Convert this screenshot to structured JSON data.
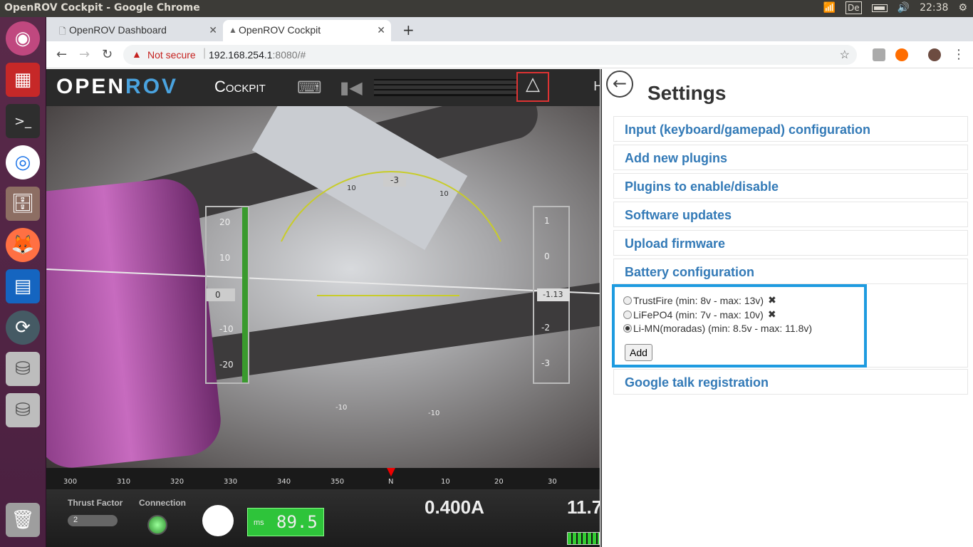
{
  "window_title": "OpenROV Cockpit - Google Chrome",
  "panel": {
    "keyboard_layout": "De",
    "clock": "22:38"
  },
  "tabs": [
    {
      "label": "OpenROV Dashboard"
    },
    {
      "label": "OpenROV Cockpit"
    }
  ],
  "address_bar": {
    "security_label": "Not secure",
    "host": "192.168.254.1",
    "port_path": ":8080/#"
  },
  "cockpit": {
    "logo_open": "OPEN",
    "logo_rov": "ROV",
    "title": "Cockpit",
    "depth_ticks": [
      "20",
      "10",
      "0",
      "-10",
      "-20"
    ],
    "depth_value": "0",
    "pitch_center": "-3",
    "pitch_labels": [
      "10",
      "10",
      "-10",
      "-10"
    ],
    "right_ticks": [
      "1",
      "0",
      "-1",
      "-2",
      "-3"
    ],
    "right_value": "-1.13",
    "compass_ticks": [
      "300",
      "310",
      "320",
      "330",
      "340",
      "350",
      "N",
      "10",
      "20",
      "30"
    ],
    "thrust_label": "Thrust Factor",
    "thrust_value": "2",
    "connection_label": "Connection",
    "ms_label": "ms",
    "ms_value": "89.5",
    "current": "0.400A",
    "voltage_partial": "11.7"
  },
  "settings": {
    "title": "Settings",
    "items": [
      "Input (keyboard/gamepad) configuration",
      "Add new plugins",
      "Plugins to enable/disable",
      "Software updates",
      "Upload firmware",
      "Battery configuration",
      "Google talk registration"
    ],
    "batteries": [
      {
        "label": "TrustFire (min: 8v - max: 13v)",
        "remove": "✖",
        "checked": false
      },
      {
        "label": "LiFePO4 (min: 7v - max: 10v)",
        "remove": "✖",
        "checked": false
      },
      {
        "label": "Li-MN(moradas) (min: 8.5v - max: 11.8v)",
        "remove": "",
        "checked": true
      }
    ],
    "add_label": "Add"
  }
}
